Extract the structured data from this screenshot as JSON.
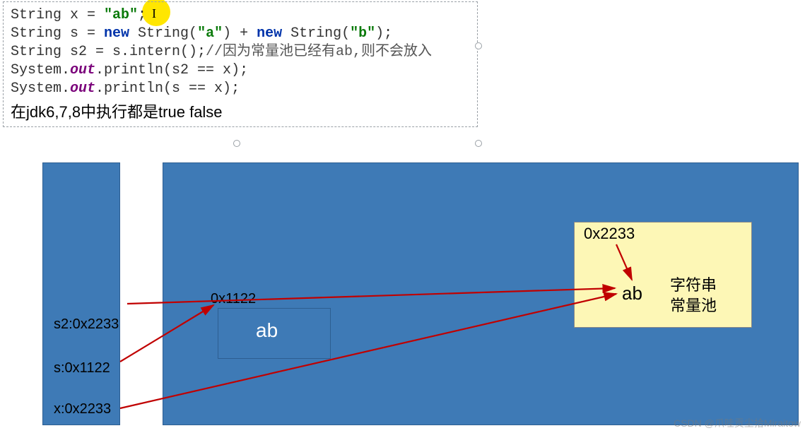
{
  "code": {
    "line1_a": "String x = ",
    "line1_str": "\"ab\"",
    "line1_b": ";",
    "line2_a": "String s = ",
    "line2_kw1": "new",
    "line2_b": " String(",
    "line2_str1": "\"a\"",
    "line2_c": ") + ",
    "line2_kw2": "new",
    "line2_d": " String(",
    "line2_str2": "\"b\"",
    "line2_e": ");",
    "line3_a": "String s2 = s.intern();",
    "line3_cmt": "//因为常量池已经有ab,则不会放入",
    "line4_a": "System.",
    "line4_out": "out",
    "line4_b": ".println(s2 == x);",
    "line5_a": "System.",
    "line5_out": "out",
    "line5_b": ".println(s == x);",
    "summary": "在jdk6,7,8中执行都是true  false"
  },
  "stack": {
    "s2": "s2:0x2233",
    "s": "s:0x1122",
    "x": "x:0x2233"
  },
  "heap": {
    "obj1122_addr": "0x1122",
    "obj1122_val": "ab",
    "pool_addr": "0x2233",
    "pool_val": "ab",
    "pool_label_l1": "字符串",
    "pool_label_l2": "常量池"
  },
  "watermark": "CSDN @爪哇贡尘拾Miraitow",
  "colors": {
    "heap_blue": "#3e7ab6",
    "pool_yellow": "#fdf7b6",
    "arrow_red": "#c00000",
    "highlight": "#ffe600"
  }
}
